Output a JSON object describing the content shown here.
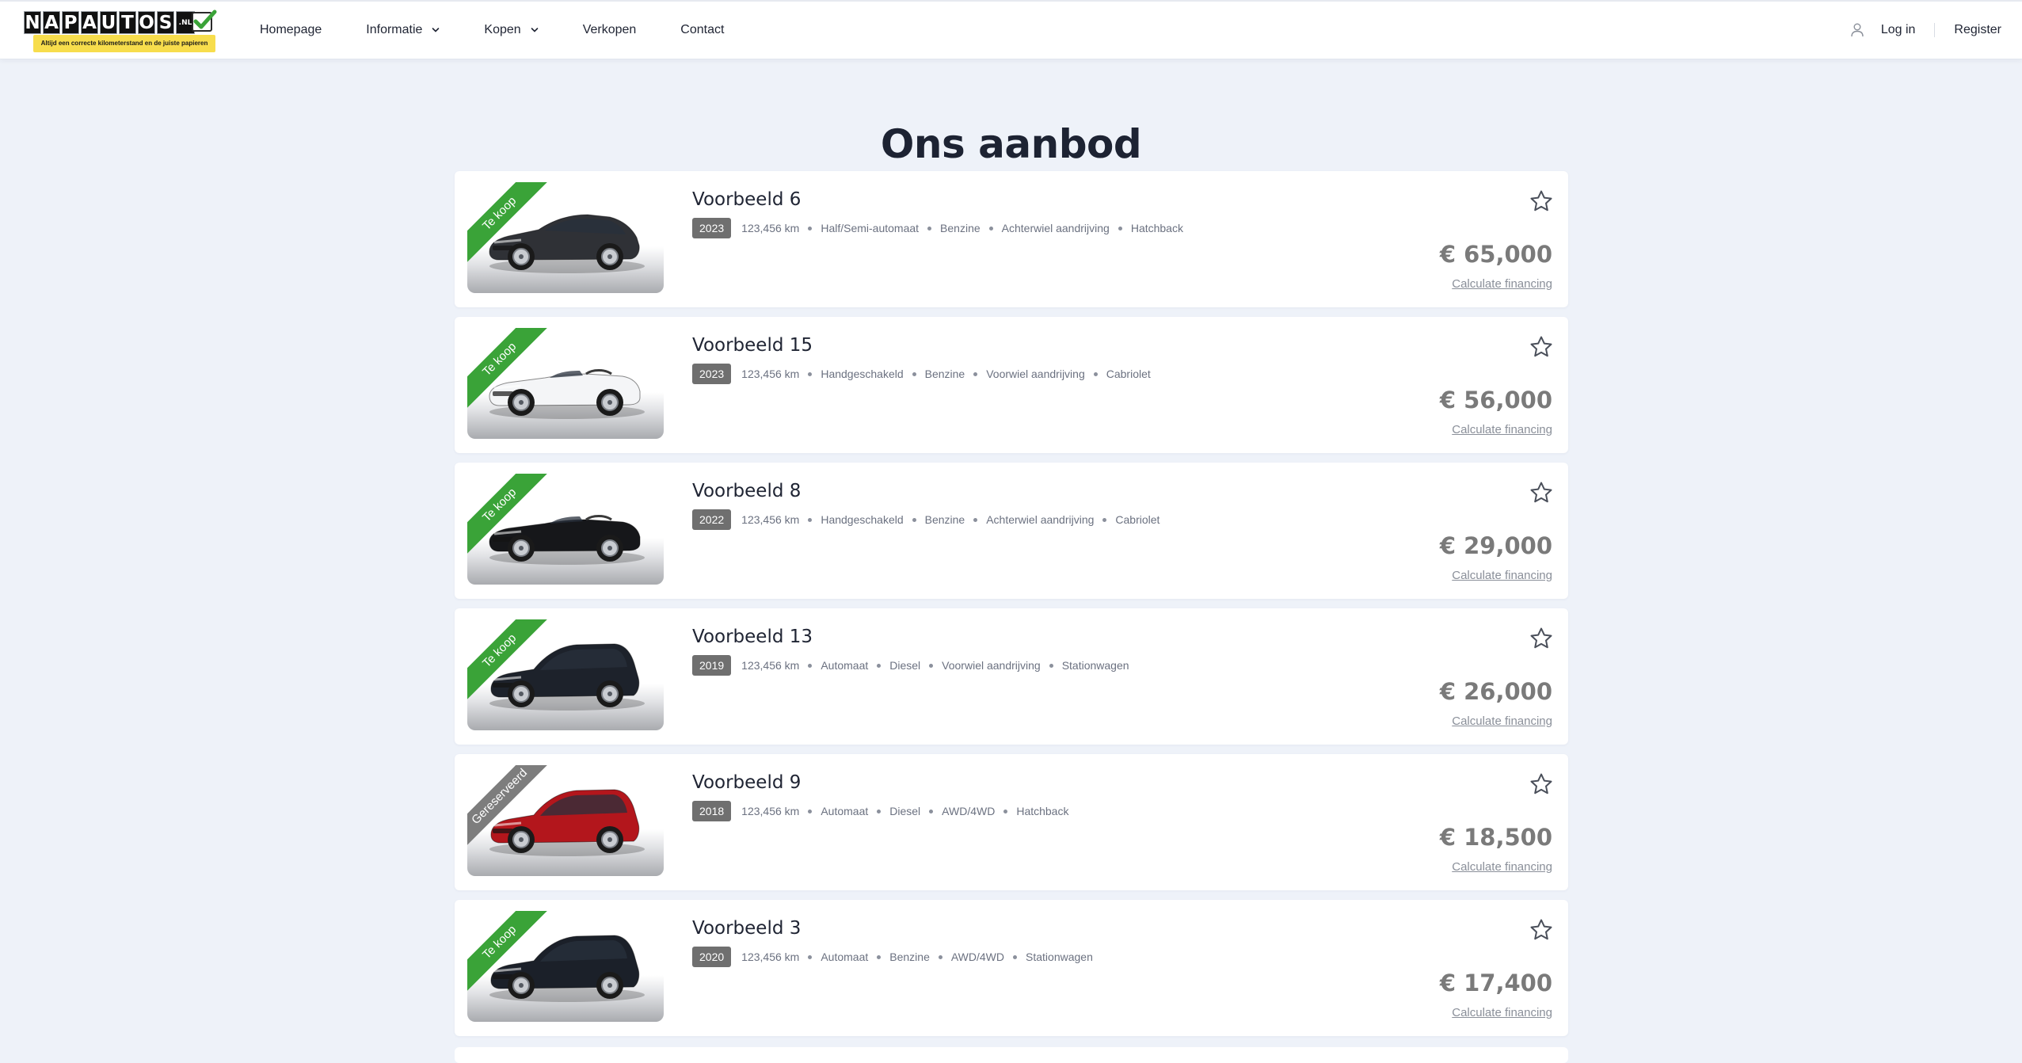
{
  "header": {
    "logo": {
      "letters": [
        "N",
        "A",
        "P",
        "A",
        "U",
        "T",
        "O",
        "S",
        ".NL"
      ],
      "tagline": "Altijd een correcte kilometerstand en de juiste papieren"
    },
    "nav": [
      {
        "label": "Homepage",
        "dropdown": false
      },
      {
        "label": "Informatie",
        "dropdown": true
      },
      {
        "label": "Kopen",
        "dropdown": true
      },
      {
        "label": "Verkopen",
        "dropdown": false
      },
      {
        "label": "Contact",
        "dropdown": false
      }
    ],
    "login_label": "Log in",
    "register_label": "Register"
  },
  "page_title": "Ons aanbod",
  "colors": {
    "for_sale_ribbon": "#3aa338",
    "reserved_ribbon": "#7d7d7d",
    "year_badge": "#6f6f6f",
    "price": "#7a7a7a",
    "background": "#eef2f9"
  },
  "listings": [
    {
      "title": "Voorbeeld 6",
      "status": "Te koop",
      "status_type": "for-sale",
      "car_color": "#2f3136",
      "car_style": "coupe",
      "year": "2023",
      "specs": [
        "123,456 km",
        "Half/Semi-automaat",
        "Benzine",
        "Achterwiel aandrijving",
        "Hatchback"
      ],
      "price": "€ 65,000",
      "financing_label": "Calculate financing"
    },
    {
      "title": "Voorbeeld 15",
      "status": "Te koop",
      "status_type": "for-sale",
      "car_color": "#f4f5f7",
      "car_style": "cabrio",
      "year": "2023",
      "specs": [
        "123,456 km",
        "Handgeschakeld",
        "Benzine",
        "Voorwiel aandrijving",
        "Cabriolet"
      ],
      "price": "€ 56,000",
      "financing_label": "Calculate financing"
    },
    {
      "title": "Voorbeeld 8",
      "status": "Te koop",
      "status_type": "for-sale",
      "car_color": "#16171a",
      "car_style": "cabrio",
      "year": "2022",
      "specs": [
        "123,456 km",
        "Handgeschakeld",
        "Benzine",
        "Achterwiel aandrijving",
        "Cabriolet"
      ],
      "price": "€ 29,000",
      "financing_label": "Calculate financing"
    },
    {
      "title": "Voorbeeld 13",
      "status": "Te koop",
      "status_type": "for-sale",
      "car_color": "#1d222b",
      "car_style": "hatch",
      "year": "2019",
      "specs": [
        "123,456 km",
        "Automaat",
        "Diesel",
        "Voorwiel aandrijving",
        "Stationwagen"
      ],
      "price": "€ 26,000",
      "financing_label": "Calculate financing"
    },
    {
      "title": "Voorbeeld 9",
      "status": "Gereserveerd",
      "status_type": "reserved",
      "car_color": "#b3161c",
      "car_style": "hatch",
      "year": "2018",
      "specs": [
        "123,456 km",
        "Automaat",
        "Diesel",
        "AWD/4WD",
        "Hatchback"
      ],
      "price": "€ 18,500",
      "financing_label": "Calculate financing"
    },
    {
      "title": "Voorbeeld 3",
      "status": "Te koop",
      "status_type": "for-sale",
      "car_color": "#1b2029",
      "car_style": "hatch",
      "year": "2020",
      "specs": [
        "123,456 km",
        "Automaat",
        "Benzine",
        "AWD/4WD",
        "Stationwagen"
      ],
      "price": "€ 17,400",
      "financing_label": "Calculate financing"
    }
  ]
}
